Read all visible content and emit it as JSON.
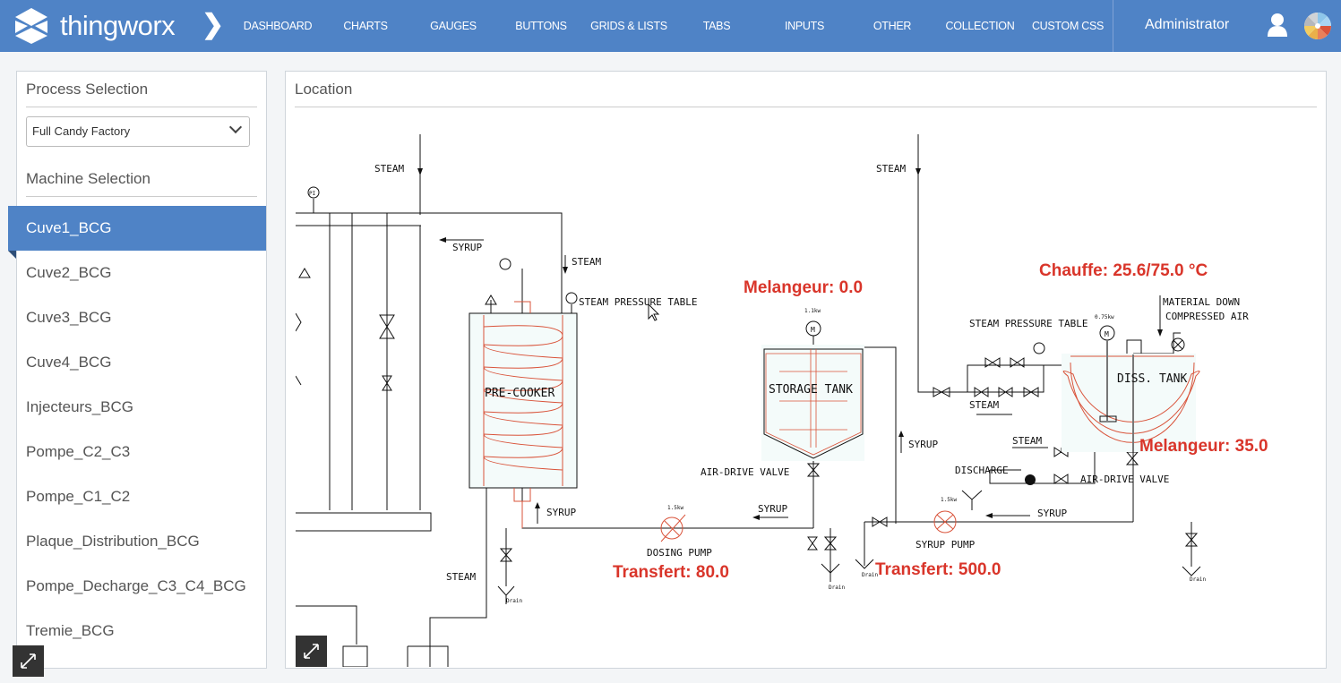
{
  "header": {
    "brand": "thingworx",
    "nav": [
      "DASHBOARD",
      "CHARTS",
      "GAUGES",
      "BUTTONS",
      "GRIDS & LISTS",
      "TABS",
      "INPUTS",
      "OTHER",
      "COLLECTION",
      "CUSTOM CSS"
    ],
    "user": "Administrator",
    "accent": "#4f83c6"
  },
  "sidebar": {
    "process_title": "Process Selection",
    "process_value": "Full Candy Factory",
    "machine_title": "Machine Selection",
    "machines": [
      "Cuve1_BCG",
      "Cuve2_BCG",
      "Cuve3_BCG",
      "Cuve4_BCG",
      "Injecteurs_BCG",
      "Pompe_C2_C3",
      "Pompe_C1_C2",
      "Plaque_Distribution_BCG",
      "Pompe_Decharge_C3_C4_BCG",
      "Tremie_BCG"
    ],
    "selected": "Cuve1_BCG"
  },
  "location": {
    "title": "Location",
    "values": {
      "melangeur1": "Melangeur: 0.0",
      "chauffe": "Chauffe: 25.6/75.0 °C",
      "melangeur2": "Melangeur: 35.0",
      "transfert1": "Transfert: 80.0",
      "transfert2": "Transfert: 500.0"
    },
    "labels": {
      "steam": "STEAM",
      "syrup": "SYRUP",
      "pi": "PI",
      "steam_pressure_table": "STEAM PRESSURE TABLE",
      "pre_cooker": "PRE-COOKER",
      "storage_tank": "STORAGE TANK",
      "diss_tank": "DISS. TANK",
      "air_drive_valve": "AIR-DRIVE VALVE",
      "dosing_pump": "DOSING PUMP",
      "syrup_pump": "SYRUP PUMP",
      "discharge": "DISCHARGE",
      "material_down": "MATERIAL DOWN",
      "compressed_air": "COMPRESSED AIR",
      "drain": "Drain",
      "motor": "M",
      "kw_storage": "1.1kw",
      "kw_diss": "0.75kw",
      "kw_dosing": "1.5kw",
      "kw_syrup": "1.5kw"
    },
    "value_color": "#d9352a"
  }
}
